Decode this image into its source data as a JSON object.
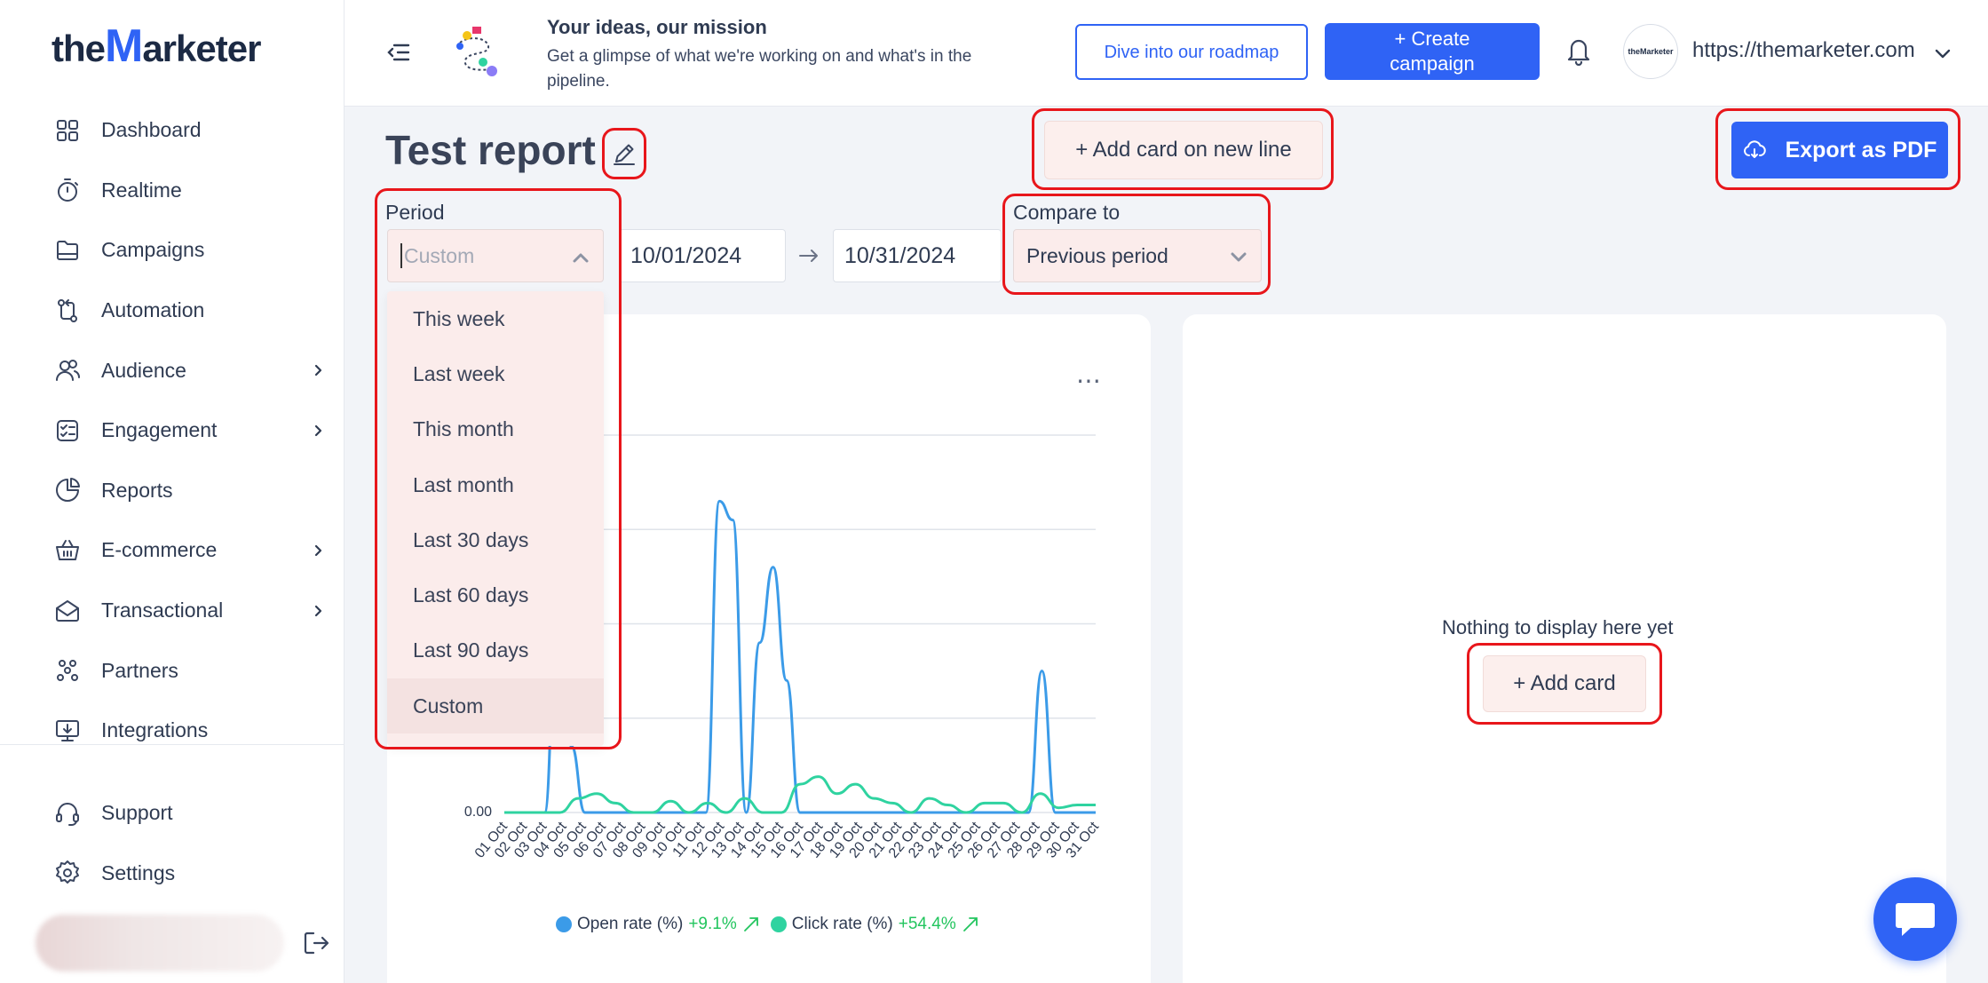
{
  "brand": {
    "logo_pre": "the",
    "logo_m": "M",
    "logo_post": "arketer",
    "avatar_text": "theMarketer"
  },
  "sidebar": {
    "items": [
      {
        "label": "Dashboard",
        "icon": "grid-icon",
        "has_chevron": false
      },
      {
        "label": "Realtime",
        "icon": "stopwatch-icon",
        "has_chevron": false
      },
      {
        "label": "Campaigns",
        "icon": "folder-icon",
        "has_chevron": false
      },
      {
        "label": "Automation",
        "icon": "automation-icon",
        "has_chevron": false
      },
      {
        "label": "Audience",
        "icon": "users-icon",
        "has_chevron": true
      },
      {
        "label": "Engagement",
        "icon": "checklist-icon",
        "has_chevron": true
      },
      {
        "label": "Reports",
        "icon": "pie-chart-icon",
        "has_chevron": false
      },
      {
        "label": "E-commerce",
        "icon": "basket-icon",
        "has_chevron": true
      },
      {
        "label": "Transactional",
        "icon": "envelope-icon",
        "has_chevron": true
      },
      {
        "label": "Partners",
        "icon": "partners-icon",
        "has_chevron": false
      },
      {
        "label": "Integrations",
        "icon": "monitor-icon",
        "has_chevron": false
      }
    ],
    "bottom": [
      {
        "label": "Support",
        "icon": "headset-icon"
      },
      {
        "label": "Settings",
        "icon": "gear-icon"
      }
    ]
  },
  "header": {
    "promo_title": "Your ideas, our mission",
    "promo_text": "Get a glimpse of what we're working on and what's in the pipeline.",
    "roadmap_label": "Dive into our roadmap",
    "create_label": "+ Create campaign",
    "site_url": "https://themarketer.com"
  },
  "report": {
    "title": "Test report",
    "add_line_label": "+ Add card on new line",
    "export_label": "Export as PDF",
    "period_label": "Period",
    "period_placeholder": "Custom",
    "date_from": "10/01/2024",
    "date_to": "10/31/2024",
    "compare_label": "Compare to",
    "compare_value": "Previous period",
    "period_options": [
      "This week",
      "Last week",
      "This month",
      "Last month",
      "Last 30 days",
      "Last 60 days",
      "Last 90 days",
      "Custom"
    ],
    "selected_option": "Custom",
    "empty_text": "Nothing to display here yet",
    "add_card_label": "+ Add card"
  },
  "colors": {
    "accent": "#2f63f5",
    "highlight": "#e8161b",
    "open_rate": "#3b9be8",
    "click_rate": "#2fd3a0",
    "positive": "#22c55e"
  },
  "chart_data": {
    "type": "line",
    "categories": [
      "01 Oct",
      "02 Oct",
      "03 Oct",
      "04 Oct",
      "05 Oct",
      "06 Oct",
      "07 Oct",
      "08 Oct",
      "09 Oct",
      "10 Oct",
      "11 Oct",
      "12 Oct",
      "13 Oct",
      "14 Oct",
      "15 Oct",
      "16 Oct",
      "17 Oct",
      "18 Oct",
      "19 Oct",
      "20 Oct",
      "21 Oct",
      "22 Oct",
      "23 Oct",
      "24 Oct",
      "25 Oct",
      "26 Oct",
      "27 Oct",
      "28 Oct",
      "29 Oct",
      "30 Oct",
      "31 Oct"
    ],
    "y_tick_label": "0.00",
    "ymax": 4,
    "series": [
      {
        "name": "Open rate (%)",
        "change": "+9.1%",
        "values": [
          0,
          0,
          0,
          0,
          2.5,
          0.7,
          0,
          0,
          0,
          0,
          0,
          0,
          0,
          0,
          0,
          0,
          3.3,
          3.1,
          0,
          1.8,
          2.6,
          1.4,
          0,
          0,
          0,
          0,
          0,
          0,
          0,
          0,
          0,
          0,
          0,
          0,
          0,
          0,
          0,
          0,
          0,
          0,
          1.5,
          0,
          0,
          0,
          0
        ]
      },
      {
        "name": "Click rate (%)",
        "change": "+54.4%",
        "values": [
          0,
          0,
          0,
          0,
          0.15,
          0.2,
          0.1,
          0,
          0,
          0.12,
          0,
          0.1,
          0,
          0.15,
          0,
          0,
          0.3,
          0.38,
          0.2,
          0.3,
          0.15,
          0.1,
          0,
          0.15,
          0.08,
          0,
          0.1,
          0.1,
          0,
          0.2,
          0.05,
          0.08,
          0.08
        ]
      }
    ]
  }
}
